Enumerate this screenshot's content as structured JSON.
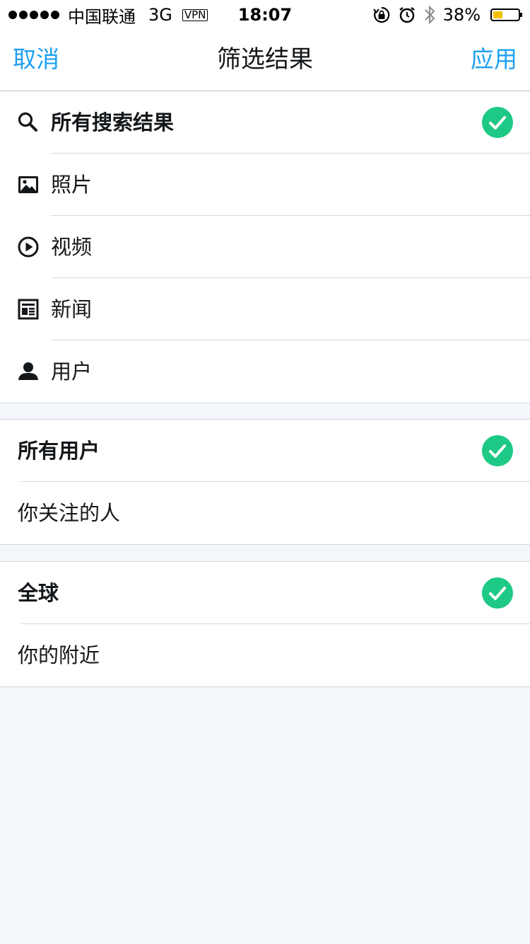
{
  "status_bar": {
    "carrier": "中国联通",
    "network": "3G",
    "vpn": "VPN",
    "time": "18:07",
    "battery_percent": "38%",
    "battery_level": 0.38,
    "signal_dots": 5,
    "icons": [
      "rotation-lock-icon",
      "alarm-icon",
      "bluetooth-icon",
      "battery-icon"
    ]
  },
  "nav": {
    "cancel_label": "取消",
    "title": "筛选结果",
    "apply_label": "应用"
  },
  "result_types": [
    {
      "label": "所有搜索结果",
      "icon": "search-icon",
      "selected": true
    },
    {
      "label": "照片",
      "icon": "photo-icon",
      "selected": false
    },
    {
      "label": "视频",
      "icon": "video-play-icon",
      "selected": false
    },
    {
      "label": "新闻",
      "icon": "news-icon",
      "selected": false
    },
    {
      "label": "用户",
      "icon": "user-icon",
      "selected": false
    }
  ],
  "people": [
    {
      "label": "所有用户",
      "selected": true
    },
    {
      "label": "你关注的人",
      "selected": false
    }
  ],
  "location": [
    {
      "label": "全球",
      "selected": true
    },
    {
      "label": "你的附近",
      "selected": false
    }
  ],
  "colors": {
    "accent": "#1da1f2",
    "check": "#1ec985",
    "background": "#f3f6fa",
    "separator": "#d4d9de"
  }
}
